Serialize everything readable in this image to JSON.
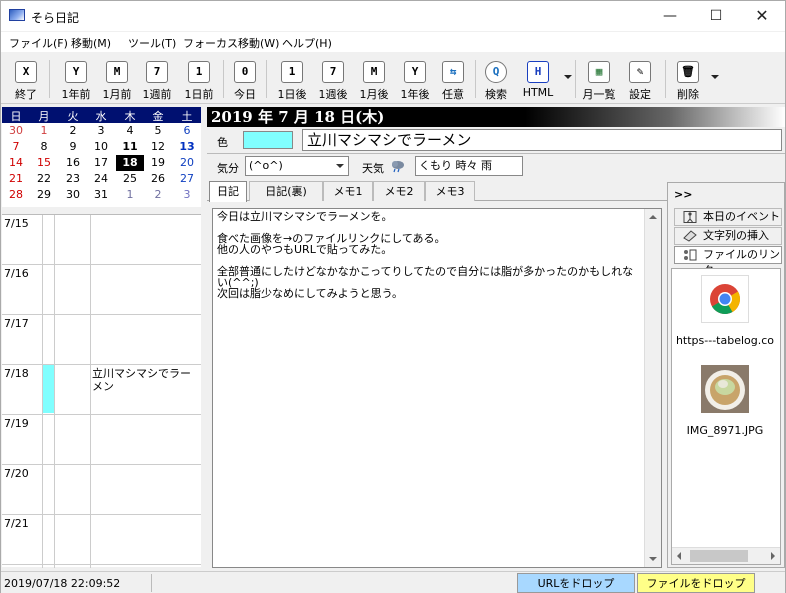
{
  "window": {
    "title": "そら日記"
  },
  "menu": [
    "ファイル(F)",
    "移動(M)",
    "ツール(T)",
    "フォーカス移動(W)",
    "ヘルプ(H)"
  ],
  "toolbar": [
    {
      "icon": "X",
      "label": "終了"
    },
    {
      "icon": "Y",
      "label": "1年前"
    },
    {
      "icon": "M",
      "label": "1月前"
    },
    {
      "icon": "7",
      "label": "1週前"
    },
    {
      "icon": "1",
      "label": "1日前"
    },
    {
      "icon": "0",
      "label": "今日"
    },
    {
      "icon": "1",
      "label": "1日後"
    },
    {
      "icon": "7",
      "label": "1週後"
    },
    {
      "icon": "M",
      "label": "1月後"
    },
    {
      "icon": "Y",
      "label": "1年後"
    },
    {
      "icon": "⇆",
      "label": "任意"
    },
    {
      "icon": "Q",
      "label": "検索"
    },
    {
      "icon": "H",
      "label": "HTML"
    },
    {
      "icon": "▦",
      "label": "月一覧"
    },
    {
      "icon": "✎",
      "label": "設定"
    },
    {
      "icon": "🗑",
      "label": "削除"
    }
  ],
  "calendar": {
    "weekdays": [
      "日",
      "月",
      "火",
      "水",
      "木",
      "金",
      "土"
    ],
    "weeks": [
      [
        "30",
        "1",
        "2",
        "3",
        "4",
        "5",
        "6"
      ],
      [
        "7",
        "8",
        "9",
        "10",
        "11",
        "12",
        "13"
      ],
      [
        "14",
        "15",
        "16",
        "17",
        "18",
        "19",
        "20"
      ],
      [
        "21",
        "22",
        "23",
        "24",
        "25",
        "26",
        "27"
      ],
      [
        "28",
        "29",
        "30",
        "31",
        "1",
        "2",
        "3"
      ]
    ],
    "selected": "18"
  },
  "week_list": [
    {
      "date": "7/15",
      "text": ""
    },
    {
      "date": "7/16",
      "text": ""
    },
    {
      "date": "7/17",
      "text": ""
    },
    {
      "date": "7/18",
      "text": "立川マシマシでラーメン"
    },
    {
      "date": "7/19",
      "text": ""
    },
    {
      "date": "7/20",
      "text": ""
    },
    {
      "date": "7/21",
      "text": ""
    }
  ],
  "entry": {
    "date_header": "2019 年 7 月 18 日(木)",
    "color_label": "色",
    "color": "#80ffff",
    "title": "立川マシマシでラーメン",
    "mood_label": "気分",
    "mood_value": "(^o^)",
    "weather_label": "天気",
    "weather_value": "くもり 時々 雨",
    "body": "今日は立川マシマシでラーメンを。\n\n食べた画像を→のファイルリンクにしてある。\n他の人のやつもURLで貼ってみた。\n\n全部普通にしたけどなかなかこってりしてたので自分には脂が多かったのかもしれない(^^;)\n次回は脂少なめにしてみようと思う。"
  },
  "tabs": [
    "日記",
    "日記(裏)",
    "メモ1",
    "メモ2",
    "メモ3"
  ],
  "right_panel": {
    "expand_label": ">>",
    "buttons": [
      "本日のイベント",
      "文字列の挿入",
      "ファイルのリンク"
    ],
    "files": [
      {
        "name": "https---tabelog.co",
        "icon": "chrome-icon"
      },
      {
        "name": "IMG_8971.JPG",
        "icon": "ramen-photo"
      }
    ]
  },
  "status": {
    "datetime": "2019/07/18 22:09:52",
    "url_drop": "URLをドロップ",
    "file_drop": "ファイルをドロップ",
    "url_drop_color": "#a8d8ff",
    "file_drop_color": "#ffff88"
  }
}
